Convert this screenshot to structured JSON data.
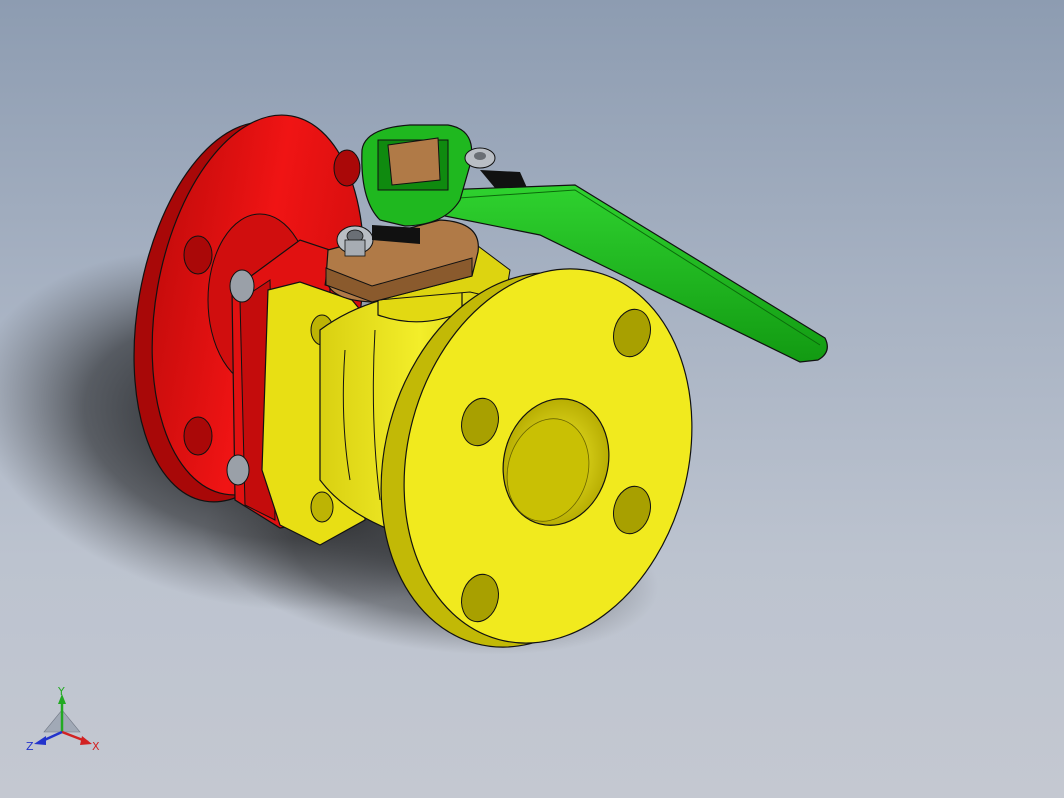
{
  "viewport": {
    "background_top": "#8d9cb1",
    "background_bottom": "#c4c8d1"
  },
  "model": {
    "part": "ball-valve",
    "colors": {
      "rear_flange": "#ee1111",
      "body": "#f1ea1e",
      "body_shade": "#b5ac00",
      "handle": "#1fb81f",
      "stem_cap": "#b07a47",
      "bolts": "#9aa0a8"
    }
  },
  "triad": {
    "y_label": "Y",
    "x_label": "X",
    "z_label": "Z",
    "colors": {
      "x": "#d22222",
      "y": "#22aa22",
      "z": "#2233cc"
    }
  }
}
